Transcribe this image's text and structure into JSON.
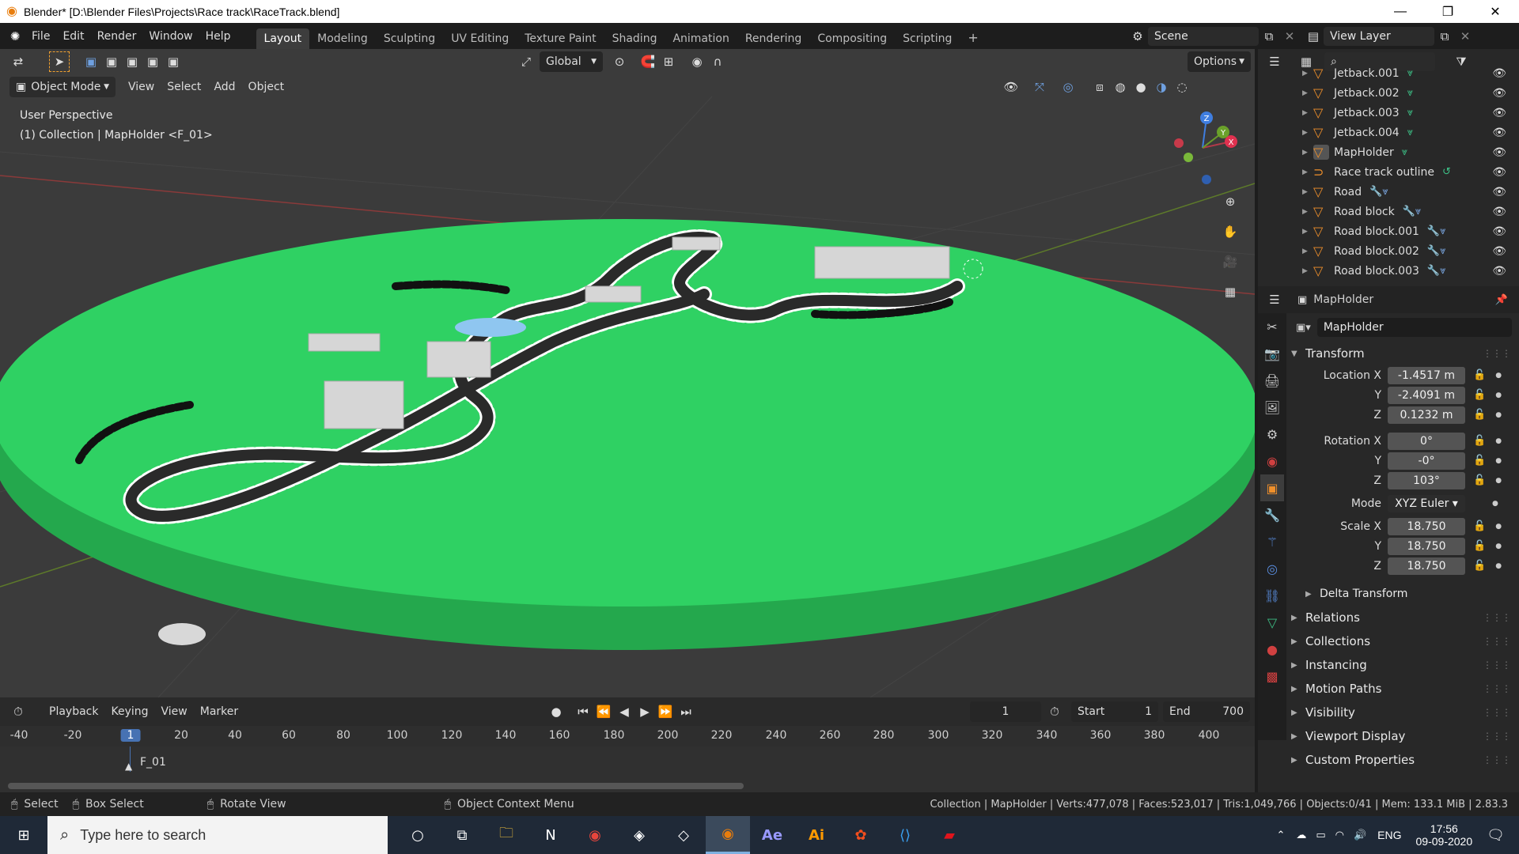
{
  "window": {
    "title": "Blender* [D:\\Blender Files\\Projects\\Race track\\RaceTrack.blend]",
    "logo_icon": "blender-logo-icon",
    "controls": [
      "minimize",
      "maximize",
      "close"
    ]
  },
  "menus": [
    "File",
    "Edit",
    "Render",
    "Window",
    "Help"
  ],
  "workspaces": [
    {
      "label": "Layout",
      "active": true
    },
    {
      "label": "Modeling"
    },
    {
      "label": "Sculpting"
    },
    {
      "label": "UV Editing"
    },
    {
      "label": "Texture Paint"
    },
    {
      "label": "Shading"
    },
    {
      "label": "Animation"
    },
    {
      "label": "Rendering"
    },
    {
      "label": "Compositing"
    },
    {
      "label": "Scripting"
    }
  ],
  "add_workspace": "+",
  "scene": {
    "label": "Scene"
  },
  "view_layer": {
    "label": "View Layer"
  },
  "toolbar": {
    "orientation": "Global",
    "options": "Options"
  },
  "viewport_header": {
    "mode": "Object Mode",
    "menus": [
      "View",
      "Select",
      "Add",
      "Object"
    ]
  },
  "viewport": {
    "perspective": "User Perspective",
    "collection_info": "(1) Collection | MapHolder <F_01>",
    "gizmo_axes": [
      "X",
      "Y",
      "Z"
    ]
  },
  "outliner": {
    "items": [
      {
        "name": "Jetback.001",
        "mods": "mesh"
      },
      {
        "name": "Jetback.002",
        "mods": "mesh"
      },
      {
        "name": "Jetback.003",
        "mods": "mesh"
      },
      {
        "name": "Jetback.004",
        "mods": "mesh"
      },
      {
        "name": "MapHolder",
        "mods": "mesh",
        "selected": true
      },
      {
        "name": "Race track outline",
        "mods": "curve"
      },
      {
        "name": "Road",
        "mods": "wrench-mesh"
      },
      {
        "name": "Road block",
        "mods": "wrench-mesh"
      },
      {
        "name": "Road block.001",
        "mods": "wrench-mesh"
      },
      {
        "name": "Road block.002",
        "mods": "wrench-mesh"
      },
      {
        "name": "Road block.003",
        "mods": "wrench-mesh"
      }
    ]
  },
  "properties": {
    "object_name_header": "MapHolder",
    "object_name_field": "MapHolder",
    "transform": {
      "header": "Transform",
      "location": {
        "label": "Location X",
        "x": "-1.4517 m",
        "y": "-2.4091 m",
        "z": "0.1232 m"
      },
      "rotation": {
        "label": "Rotation X",
        "x": "0°",
        "y": "-0°",
        "z": "103°"
      },
      "mode": {
        "label": "Mode",
        "value": "XYZ Euler"
      },
      "scale": {
        "label": "Scale X",
        "x": "18.750",
        "y": "18.750",
        "z": "18.750"
      },
      "axis_y": "Y",
      "axis_z": "Z",
      "delta": "Delta Transform"
    },
    "panels": [
      "Relations",
      "Collections",
      "Instancing",
      "Motion Paths",
      "Visibility",
      "Viewport Display",
      "Custom Properties"
    ]
  },
  "timeline": {
    "menus": [
      "Playback",
      "Keying",
      "View",
      "Marker"
    ],
    "current_frame": "1",
    "start_label": "Start",
    "start": "1",
    "end_label": "End",
    "end": "700",
    "ruler": [
      "-40",
      "-20",
      "1",
      "20",
      "40",
      "60",
      "80",
      "100",
      "120",
      "140",
      "160",
      "180",
      "200",
      "220",
      "240",
      "260",
      "280",
      "300",
      "320",
      "340",
      "360",
      "380",
      "400"
    ],
    "marker": "F_01"
  },
  "statusbar": {
    "select": "Select",
    "box_select": "Box Select",
    "rotate_view": "Rotate View",
    "context_menu": "Object Context Menu",
    "info": "Collection | MapHolder | Verts:477,078 | Faces:523,017 | Tris:1,049,766 | Objects:0/41 | Mem: 133.1 MiB | 2.83.3"
  },
  "taskbar": {
    "search_placeholder": "Type here to search",
    "apps": [
      "cortana",
      "task-view",
      "file-explorer",
      "notion",
      "chrome",
      "unity",
      "unity-hub",
      "blender",
      "after-effects",
      "illustrator",
      "figma",
      "vscode",
      "nfs"
    ],
    "ae": "Ae",
    "ai": "Ai",
    "lang": "ENG",
    "time": "17:56",
    "date": "09-09-2020"
  },
  "colors": {
    "ground": "#2fd163",
    "ground_edge": "#26b052",
    "road": "#2a2a2a",
    "accent": "#4772b3",
    "object_orange": "#f0902b"
  }
}
